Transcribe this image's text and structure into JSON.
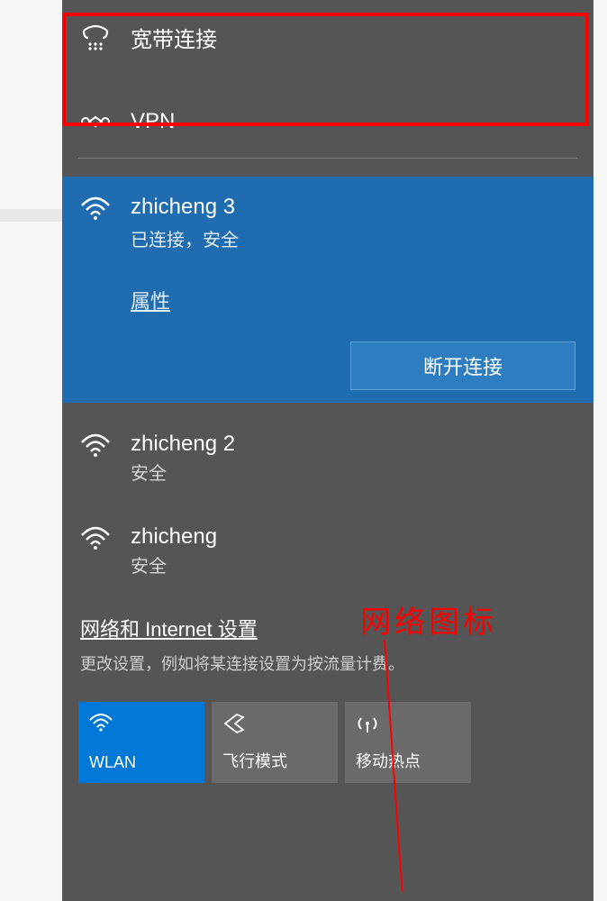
{
  "broadband": {
    "label": "宽带连接"
  },
  "vpn": {
    "label": "VPN"
  },
  "connected": {
    "name": "zhicheng 3",
    "status": "已连接，安全",
    "properties": "属性",
    "disconnect": "断开连接"
  },
  "networks": [
    {
      "name": "zhicheng 2",
      "status": "安全"
    },
    {
      "name": "zhicheng",
      "status": "安全"
    }
  ],
  "settings": {
    "title": "网络和 Internet 设置",
    "desc": "更改设置，例如将某连接设置为按流量计费。"
  },
  "tiles": {
    "wlan": "WLAN",
    "airplane": "飞行模式",
    "hotspot": "移动热点"
  },
  "annotation": "网络图标"
}
